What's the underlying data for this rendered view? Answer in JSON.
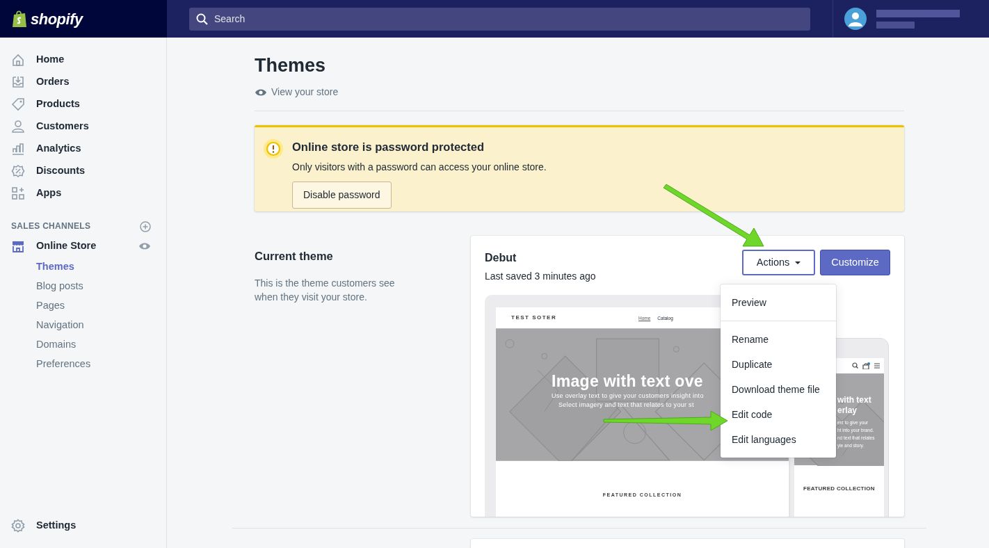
{
  "brand": {
    "name": "shopify"
  },
  "search": {
    "placeholder": "Search"
  },
  "sidebar": {
    "items": [
      {
        "label": "Home",
        "selected": false
      },
      {
        "label": "Orders",
        "selected": false
      },
      {
        "label": "Products",
        "selected": false
      },
      {
        "label": "Customers",
        "selected": false
      },
      {
        "label": "Analytics",
        "selected": false
      },
      {
        "label": "Discounts",
        "selected": false
      },
      {
        "label": "Apps",
        "selected": false
      }
    ],
    "section_title": "SALES CHANNELS",
    "channel": {
      "label": "Online Store",
      "children": [
        {
          "label": "Themes",
          "selected": true
        },
        {
          "label": "Blog posts",
          "selected": false
        },
        {
          "label": "Pages",
          "selected": false
        },
        {
          "label": "Navigation",
          "selected": false
        },
        {
          "label": "Domains",
          "selected": false
        },
        {
          "label": "Preferences",
          "selected": false
        }
      ]
    },
    "settings": {
      "label": "Settings"
    }
  },
  "page": {
    "title": "Themes",
    "view_link": "View your store"
  },
  "banner": {
    "title": "Online store is password protected",
    "text": "Only visitors with a password can access your online store.",
    "button": "Disable password"
  },
  "current_theme": {
    "heading": "Current theme",
    "description": "This is the theme customers see when they visit your store.",
    "name": "Debut",
    "saved": "Last saved 3 minutes ago",
    "actions": {
      "label": "Actions",
      "expanded": true
    },
    "customize_button": "Customize",
    "menu_sections": [
      {
        "items": [
          "Preview"
        ]
      },
      {
        "items": [
          "Rename",
          "Duplicate",
          "Download theme file",
          "Edit code",
          "Edit languages"
        ]
      }
    ],
    "preview": {
      "store_name": "TEST SOTER",
      "nav": [
        {
          "label": "Home",
          "selected": true
        },
        {
          "label": "Catalog",
          "selected": false
        }
      ],
      "hero_title": "Image with text ove",
      "hero_lines": [
        "Use overlay text to give your customers insight into",
        "Select imagery and text that relates to your st"
      ],
      "featured": "FEATURED COLLECTION",
      "mobile": {
        "hero_title_lines": [
          "with text",
          "erlay"
        ],
        "hero_lines": [
          "ext to give your",
          "ht into your brand.",
          "nd text that relates",
          "yle and story."
        ],
        "featured": "FEATURED COLLECTION"
      }
    }
  }
}
